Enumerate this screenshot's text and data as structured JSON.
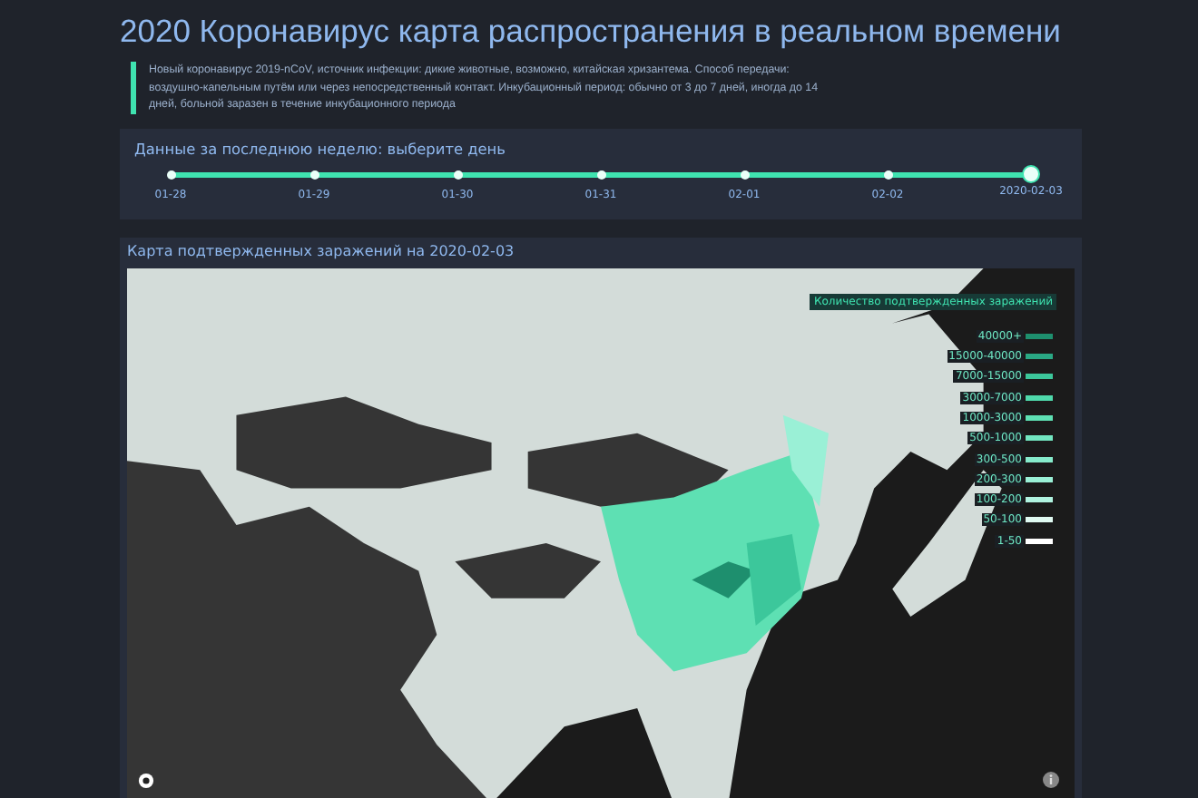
{
  "title": "2020 Коронавирус карта распространения в реальном времени",
  "description": "Новый коронавирус 2019-nCoV, источник инфекции: дикие животные, возможно, китайская хризантема. Способ передачи: воздушно-капельным путём или через непосредственный контакт. Инкубационный период: обычно от 3 до 7 дней, иногда до 14 дней, больной заразен в течение инкубационного периода",
  "date_slider": {
    "label": "Данные за последнюю неделю: выберите день",
    "days": [
      {
        "label": "01-28",
        "selected": false
      },
      {
        "label": "01-29",
        "selected": false
      },
      {
        "label": "01-30",
        "selected": false
      },
      {
        "label": "01-31",
        "selected": false
      },
      {
        "label": "02-01",
        "selected": false
      },
      {
        "label": "02-02",
        "selected": false
      },
      {
        "label": "2020-02-03",
        "selected": true
      }
    ]
  },
  "map_panel": {
    "title": "Карта подтвержденных заражений на 2020-02-03",
    "legend": {
      "title": "Количество подтвержденных заражений",
      "items": [
        {
          "label": "40000+",
          "color": "#1e8f6e"
        },
        {
          "label": "15000-40000",
          "color": "#2aa884"
        },
        {
          "label": "7000-15000",
          "color": "#3cc79b"
        },
        {
          "label": "3000-7000",
          "color": "#4fd9ab"
        },
        {
          "label": "1000-3000",
          "color": "#5ee0b3"
        },
        {
          "label": "500-1000",
          "color": "#72e6c0"
        },
        {
          "label": "300-500",
          "color": "#86ebcb"
        },
        {
          "label": "200-300",
          "color": "#9af0d6"
        },
        {
          "label": "100-200",
          "color": "#b0f3e0"
        },
        {
          "label": "50-100",
          "color": "#e0faf2"
        },
        {
          "label": "1-50",
          "color": "#ffffff"
        }
      ]
    }
  }
}
